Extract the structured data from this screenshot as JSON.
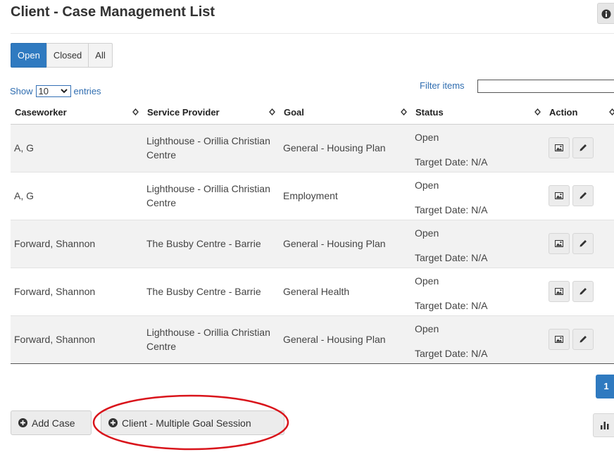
{
  "page": {
    "title": "Client - Case Management List"
  },
  "filters": {
    "open": "Open",
    "closed": "Closed",
    "all": "All"
  },
  "entries": {
    "show": "Show",
    "value": "10",
    "suffix": "entries"
  },
  "search": {
    "label": "Filter items",
    "value": ""
  },
  "table": {
    "columns": [
      "Caseworker",
      "Service Provider",
      "Goal",
      "Status",
      "Action"
    ],
    "rows": [
      {
        "caseworker": "A, G",
        "provider": "Lighthouse - Orillia Christian Centre",
        "goal": "General - Housing Plan",
        "status": "Open",
        "target": "Target Date: N/A"
      },
      {
        "caseworker": "A, G",
        "provider": "Lighthouse - Orillia Christian Centre",
        "goal": "Employment",
        "status": "Open",
        "target": "Target Date: N/A"
      },
      {
        "caseworker": "Forward, Shannon",
        "provider": "The Busby Centre - Barrie",
        "goal": "General - Housing Plan",
        "status": "Open",
        "target": "Target Date: N/A"
      },
      {
        "caseworker": "Forward, Shannon",
        "provider": "The Busby Centre - Barrie",
        "goal": "General Health",
        "status": "Open",
        "target": "Target Date: N/A"
      },
      {
        "caseworker": "Forward, Shannon",
        "provider": "Lighthouse - Orillia Christian Centre",
        "goal": "General - Housing Plan",
        "status": "Open",
        "target": "Target Date: N/A"
      }
    ]
  },
  "pagination": {
    "current": "1"
  },
  "buttons": {
    "add_case": "Add Case",
    "multiple_goal": "Client - Multiple Goal Session"
  },
  "icons": {
    "info": "info-icon",
    "sort": "sort-icon",
    "view": "image-icon",
    "edit": "pencil-icon",
    "add": "plus-circle-icon",
    "chart": "bar-chart-icon",
    "dropdown": "chevron-down-icon"
  },
  "colors": {
    "primary": "#2f7ac0",
    "highlight": "#d9141b",
    "row_shade": "#f2f2f2"
  }
}
